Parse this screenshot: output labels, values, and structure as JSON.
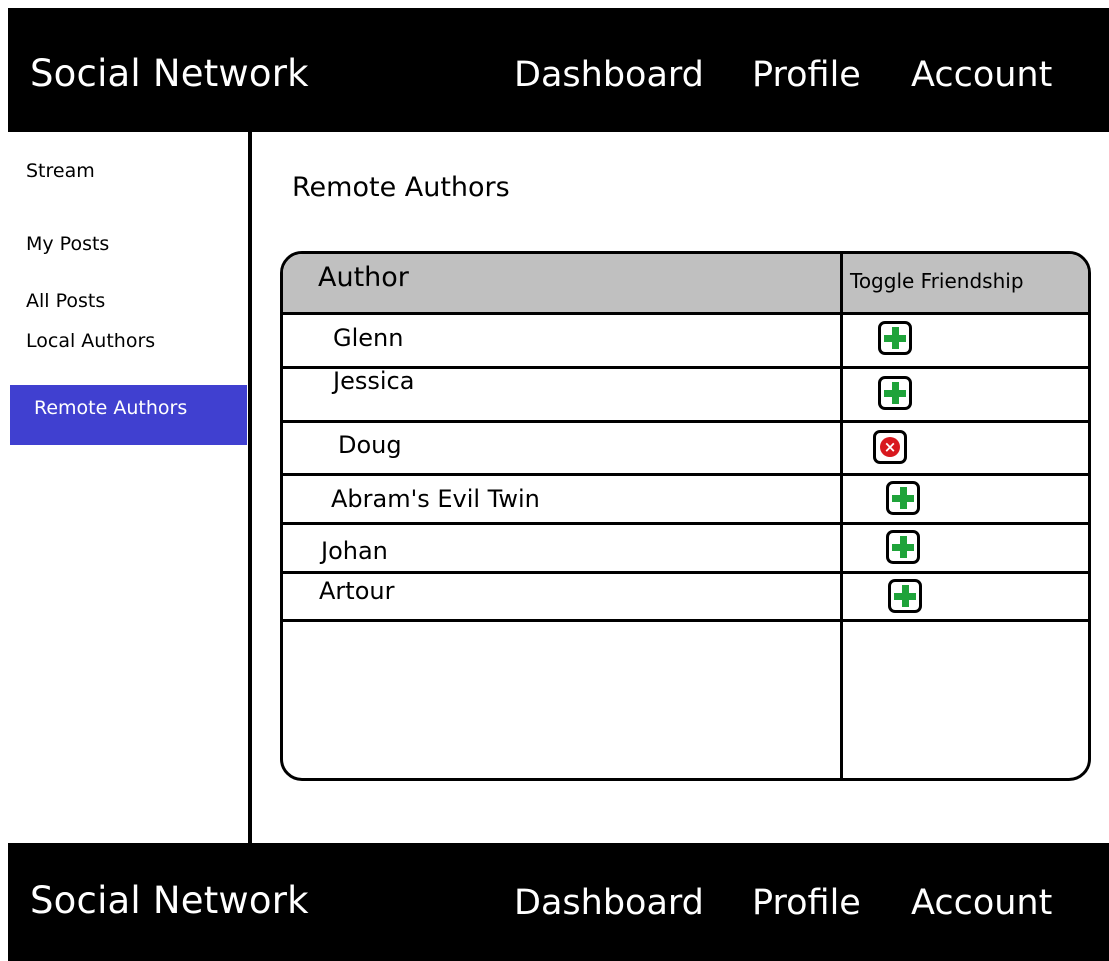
{
  "header": {
    "brand": "Social Network",
    "nav": {
      "dashboard": "Dashboard",
      "profile": "Profile",
      "account": "Account"
    }
  },
  "footer": {
    "brand": "Social Network",
    "nav": {
      "dashboard": "Dashboard",
      "profile": "Profile",
      "account": "Account"
    }
  },
  "sidebar": {
    "items": [
      {
        "label": "Stream"
      },
      {
        "label": "My Posts"
      },
      {
        "label": "All Posts"
      },
      {
        "label": "Local Authors"
      },
      {
        "label": "Remote Authors",
        "active": true
      }
    ],
    "active_color": "#4040d0"
  },
  "main": {
    "title": "Remote Authors",
    "table": {
      "headers": {
        "author": "Author",
        "toggle": "Toggle Friendship"
      },
      "rows": [
        {
          "name": "Glenn",
          "action": "add-friend-icon"
        },
        {
          "name": "Jessica",
          "action": "add-friend-icon"
        },
        {
          "name": "Doug",
          "action": "remove-friend-icon"
        },
        {
          "name": "Abram's Evil Twin",
          "action": "add-friend-icon"
        },
        {
          "name": "Johan",
          "action": "add-friend-icon"
        },
        {
          "name": "Artour",
          "action": "add-friend-icon"
        }
      ]
    }
  },
  "colors": {
    "add": "#1fa33a",
    "remove": "#d8181e",
    "header_bg": "#c0c0c0"
  }
}
